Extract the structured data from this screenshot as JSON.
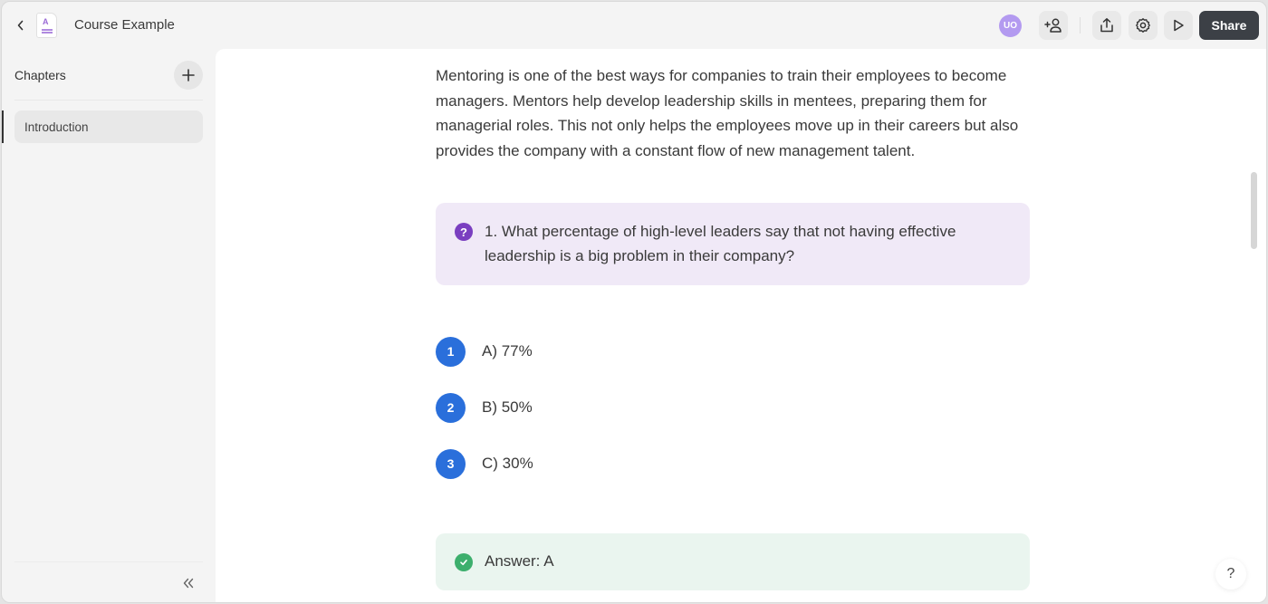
{
  "header": {
    "title": "Course Example",
    "avatar_initials": "UO",
    "share_label": "Share",
    "icons": [
      "chevron-left-icon",
      "document-icon",
      "add-user-icon",
      "export-icon",
      "gear-icon",
      "play-icon"
    ]
  },
  "sidebar": {
    "heading": "Chapters",
    "add_label": "+",
    "items": [
      {
        "label": "Introduction",
        "active": true
      }
    ],
    "collapse_label": "«"
  },
  "main": {
    "paragraph": "Mentoring is one of the best ways for companies to train their employees to become managers. Mentors help develop leadership skills in mentees, preparing them for managerial roles. This not only helps the employees move up in their careers but also provides the company with a constant flow of new management talent.",
    "question": {
      "icon": "?",
      "text": "1. What percentage of high-level leaders say that not having effective leadership is a big problem in their company?"
    },
    "options": [
      {
        "number": "1",
        "label": "A) 77%"
      },
      {
        "number": "2",
        "label": "B) 50%"
      },
      {
        "number": "3",
        "label": "C) 30%"
      }
    ],
    "answer": {
      "text": "Answer: A"
    },
    "help_label": "?"
  },
  "colors": {
    "accent_blue": "#2a6fdb",
    "question_bg": "#f0e9f7",
    "question_icon": "#7a3fc0",
    "answer_bg": "#eaf5ef",
    "answer_icon": "#3daf6d",
    "share_bg": "#3c4046",
    "avatar_bg": "#b39af0"
  }
}
